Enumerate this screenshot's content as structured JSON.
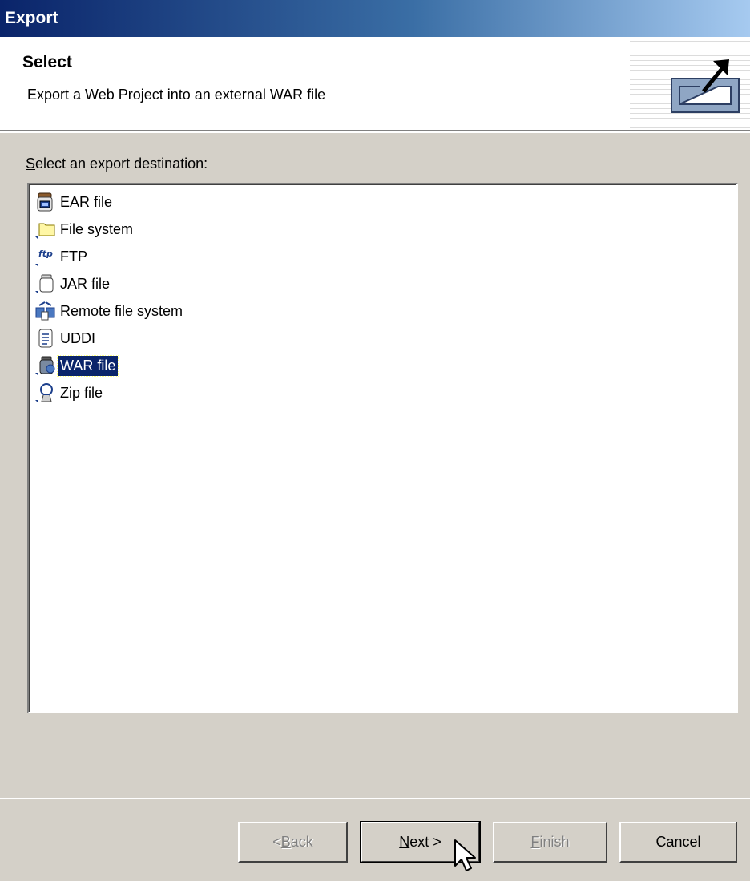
{
  "window": {
    "title": "Export"
  },
  "header": {
    "title": "Select",
    "description": "Export a Web Project into an external WAR file",
    "icon": "export-icon"
  },
  "list": {
    "label_mnemonic": "S",
    "label_rest": "elect an export destination:",
    "items": [
      {
        "label": "EAR file",
        "icon": "ear-file-icon"
      },
      {
        "label": "File system",
        "icon": "folder-icon"
      },
      {
        "label": "FTP",
        "icon": "ftp-icon"
      },
      {
        "label": "JAR file",
        "icon": "jar-file-icon"
      },
      {
        "label": "Remote file system",
        "icon": "remote-file-system-icon"
      },
      {
        "label": "UDDI",
        "icon": "uddi-icon"
      },
      {
        "label": "WAR file",
        "icon": "war-file-icon",
        "selected": true
      },
      {
        "label": "Zip file",
        "icon": "zip-file-icon"
      }
    ]
  },
  "buttons": {
    "back": {
      "pre": "< ",
      "mnemonic": "B",
      "post": "ack",
      "enabled": false
    },
    "next": {
      "pre": "",
      "mnemonic": "N",
      "post": "ext >",
      "enabled": true
    },
    "finish": {
      "pre": "",
      "mnemonic": "F",
      "post": "inish",
      "enabled": false
    },
    "cancel": {
      "label": "Cancel",
      "enabled": true
    }
  },
  "colors": {
    "title_bar_start": "#0a246a",
    "title_bar_end": "#a6caf0",
    "selection": "#0a246a",
    "dialog_bg": "#d4d0c8"
  }
}
